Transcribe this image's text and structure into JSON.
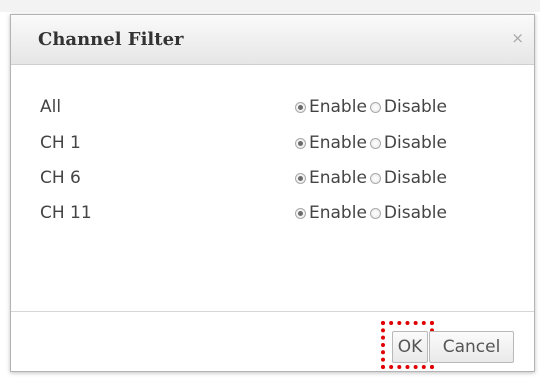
{
  "dialog": {
    "title": "Channel Filter",
    "close_glyph": "×"
  },
  "filters": [
    {
      "label": "All",
      "enable_label": "Enable",
      "disable_label": "Disable",
      "selected": "Enable"
    },
    {
      "label": "CH 1",
      "enable_label": "Enable",
      "disable_label": "Disable",
      "selected": "Enable"
    },
    {
      "label": "CH 6",
      "enable_label": "Enable",
      "disable_label": "Disable",
      "selected": "Enable"
    },
    {
      "label": "CH 11",
      "enable_label": "Enable",
      "disable_label": "Disable",
      "selected": "Enable"
    }
  ],
  "buttons": {
    "ok_label": "OK",
    "cancel_label": "Cancel"
  },
  "colors": {
    "highlight": "#e00000"
  }
}
